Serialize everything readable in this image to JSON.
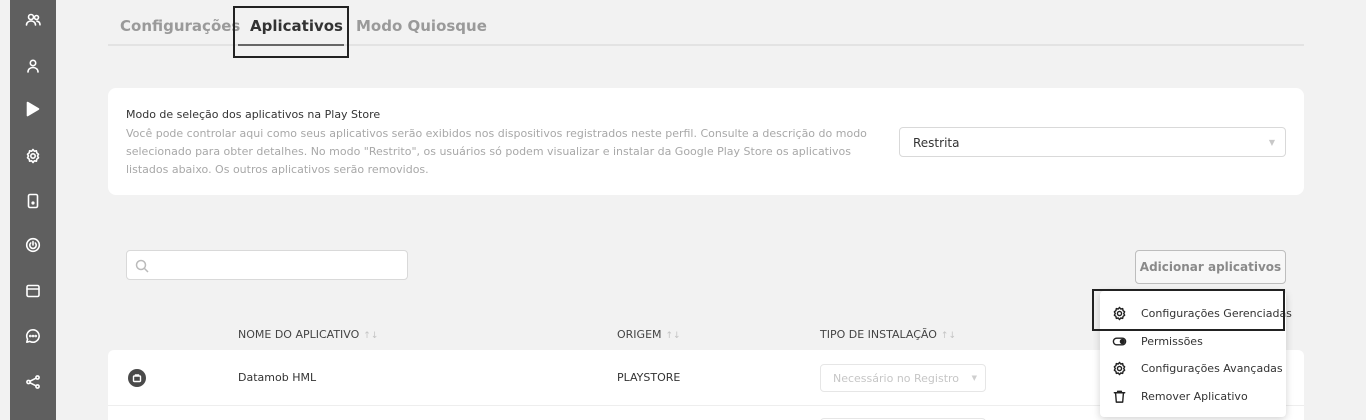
{
  "tabs": {
    "configuracoes": "Configurações",
    "aplicativos": "Aplicativos",
    "modo_quiosque": "Modo Quiosque"
  },
  "play_store": {
    "title": "Modo de seleção dos aplicativos na Play Store",
    "description": "Você pode controlar aqui como seus aplicativos serão exibidos nos dispositivos registrados neste perfil. Consulte a descrição do modo selecionado para obter detalhes. No modo \"Restrito\", os usuários só podem visualizar e instalar da Google Play Store os aplicativos listados abaixo. Os outros aplicativos serão removidos.",
    "selected_mode": "Restrita"
  },
  "search": {
    "placeholder": ""
  },
  "toolbar": {
    "add_apps_label": "Adicionar aplicativos"
  },
  "table": {
    "columns": [
      "NOME DO APLICATIVO",
      "ORIGEM",
      "TIPO DE INSTALAÇÃO"
    ],
    "sort_glyph": "↑↓",
    "rows": [
      {
        "name": "Datamob HML",
        "origin": "PLAYSTORE",
        "install_type": "Necessário no Registro"
      }
    ]
  },
  "context_menu": {
    "items": [
      {
        "label": "Configurações Gerenciadas",
        "icon": "gear-icon"
      },
      {
        "label": "Permissões",
        "icon": "toggle-icon"
      },
      {
        "label": "Configurações Avançadas",
        "icon": "gear-icon"
      },
      {
        "label": "Remover Aplicativo",
        "icon": "trash-icon"
      }
    ]
  },
  "sidebar": {
    "icons": [
      "users-icon",
      "user-icon",
      "play-store-icon",
      "settings-icon",
      "device-icon",
      "power-icon",
      "window-icon",
      "chat-icon",
      "share-icon"
    ]
  },
  "colors": {
    "rail": "#5f5f5f",
    "background": "#f2f2f2",
    "card": "#ffffff",
    "active_tab": "#333333",
    "inactive_tab": "#9a9a9a"
  }
}
